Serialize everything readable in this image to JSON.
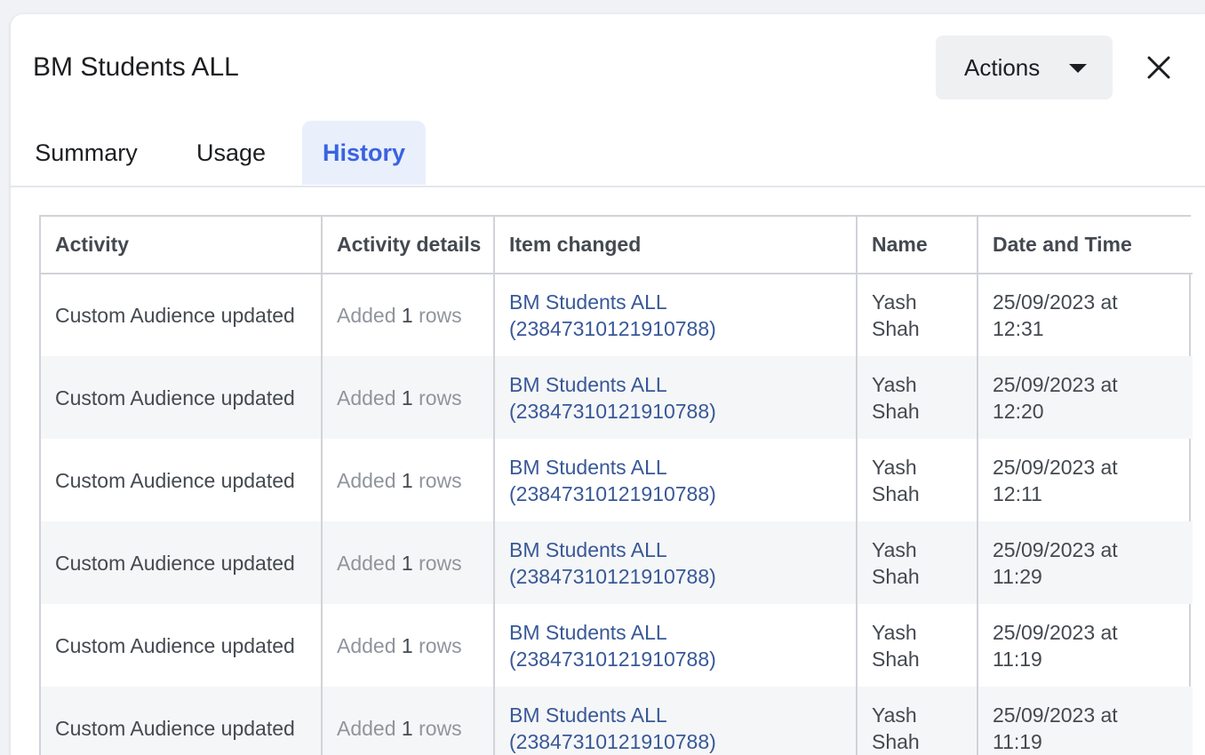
{
  "header": {
    "title": "BM Students ALL",
    "actions_label": "Actions"
  },
  "tabs": [
    {
      "label": "Summary",
      "active": false
    },
    {
      "label": "Usage",
      "active": false
    },
    {
      "label": "History",
      "active": true
    }
  ],
  "table": {
    "columns": [
      "Activity",
      "Activity details",
      "Item changed",
      "Name",
      "Date and Time"
    ],
    "rows": [
      {
        "activity": "Custom Audience updated",
        "details_prefix": "Added",
        "details_count": "1",
        "details_suffix": "rows",
        "item_line1": "BM Students ALL",
        "item_line2": "(23847310121910788)",
        "name_first": "Yash",
        "name_last": "Shah",
        "date": "25/09/2023 at",
        "time": "12:31"
      },
      {
        "activity": "Custom Audience updated",
        "details_prefix": "Added",
        "details_count": "1",
        "details_suffix": "rows",
        "item_line1": "BM Students ALL",
        "item_line2": "(23847310121910788)",
        "name_first": "Yash",
        "name_last": "Shah",
        "date": "25/09/2023 at",
        "time": "12:20"
      },
      {
        "activity": "Custom Audience updated",
        "details_prefix": "Added",
        "details_count": "1",
        "details_suffix": "rows",
        "item_line1": "BM Students ALL",
        "item_line2": "(23847310121910788)",
        "name_first": "Yash",
        "name_last": "Shah",
        "date": "25/09/2023 at",
        "time": "12:11"
      },
      {
        "activity": "Custom Audience updated",
        "details_prefix": "Added",
        "details_count": "1",
        "details_suffix": "rows",
        "item_line1": "BM Students ALL",
        "item_line2": "(23847310121910788)",
        "name_first": "Yash",
        "name_last": "Shah",
        "date": "25/09/2023 at",
        "time": "11:29"
      },
      {
        "activity": "Custom Audience updated",
        "details_prefix": "Added",
        "details_count": "1",
        "details_suffix": "rows",
        "item_line1": "BM Students ALL",
        "item_line2": "(23847310121910788)",
        "name_first": "Yash",
        "name_last": "Shah",
        "date": "25/09/2023 at",
        "time": "11:19"
      },
      {
        "activity": "Custom Audience updated",
        "details_prefix": "Added",
        "details_count": "1",
        "details_suffix": "rows",
        "item_line1": "BM Students ALL",
        "item_line2": "(23847310121910788)",
        "name_first": "Yash",
        "name_last": "Shah",
        "date": "25/09/2023 at",
        "time": "11:19"
      }
    ]
  },
  "colors": {
    "accent": "#3a63e0",
    "link": "#385898",
    "tab_active_bg": "#e9f0fc"
  },
  "icons": {
    "actions_caret": "caret-down-icon",
    "close": "close-icon"
  }
}
